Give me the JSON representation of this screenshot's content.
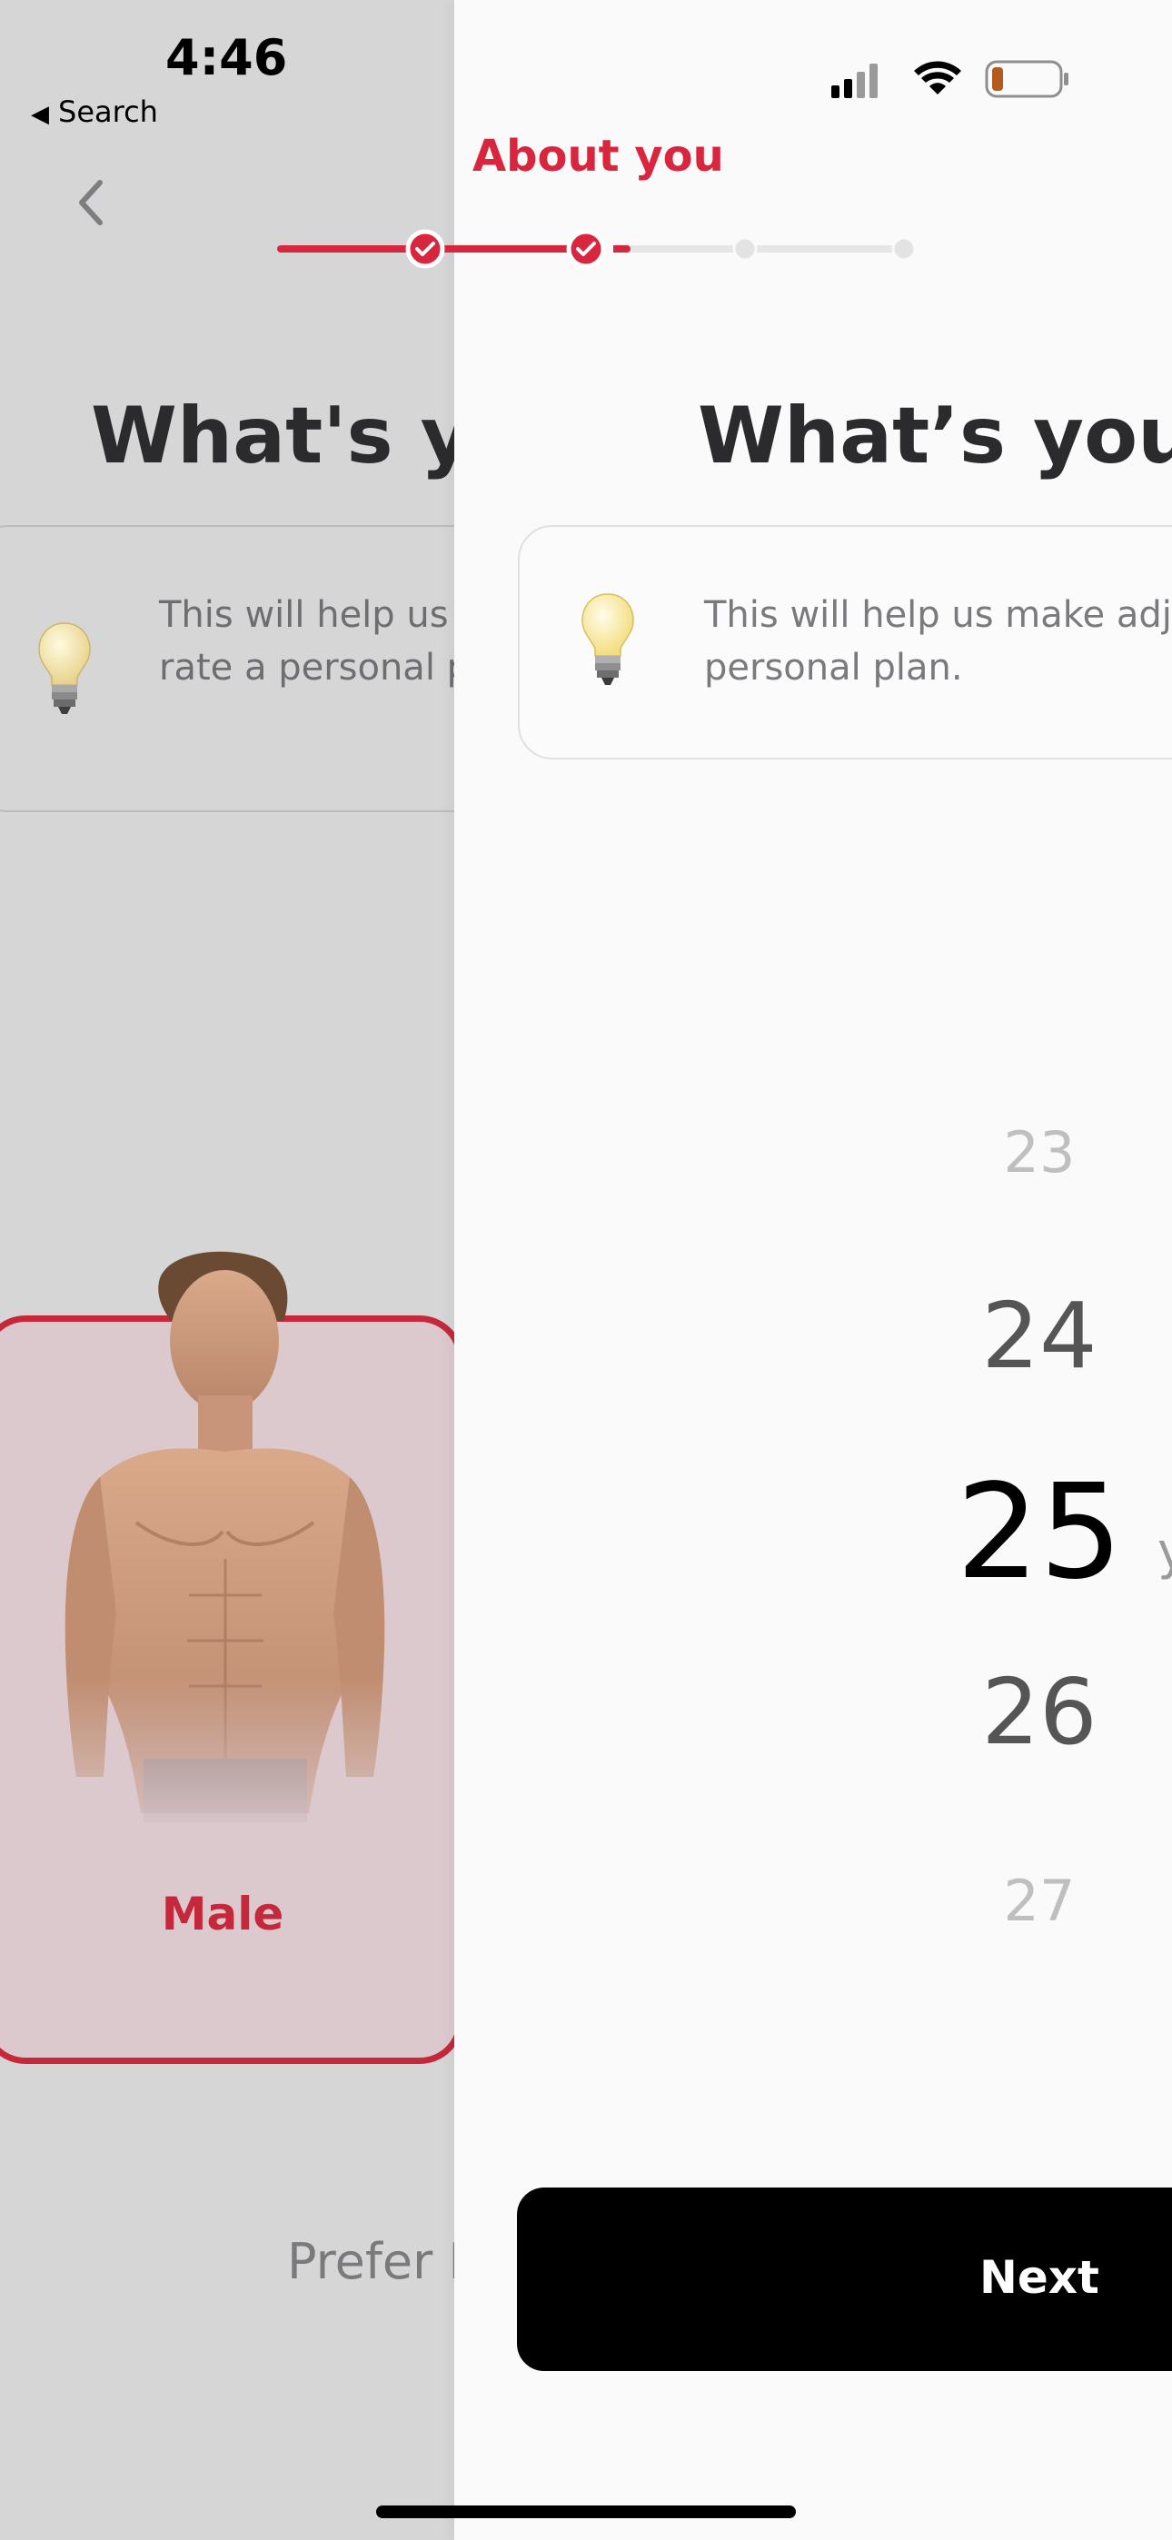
{
  "status_bar": {
    "time": "4:46",
    "back_app_label": "Search"
  },
  "header": {
    "title": "About you",
    "progress_steps_done": 2,
    "progress_steps_total": 4
  },
  "previous_screen": {
    "question_title": "What's yo",
    "tip_text": "This will help us metabolic rate a personal plan.",
    "option_label": "Male",
    "prefer_text": "Prefer I"
  },
  "current_screen": {
    "question_title": "What’s your",
    "tip_text": "This will help us make adj personal plan.",
    "age_wheel": {
      "values": [
        "23",
        "24",
        "25",
        "26",
        "27"
      ],
      "selected": "25",
      "unit": "y"
    },
    "next_button_label": "Next"
  },
  "colors": {
    "accent": "#d8263f",
    "under_bg": "#d6d6d6",
    "panel_bg": "#fafafa",
    "button_bg": "#000000"
  },
  "icons": {
    "tip": "lightbulb-icon",
    "back": "chevron-left-icon",
    "step_done": "check-icon"
  }
}
